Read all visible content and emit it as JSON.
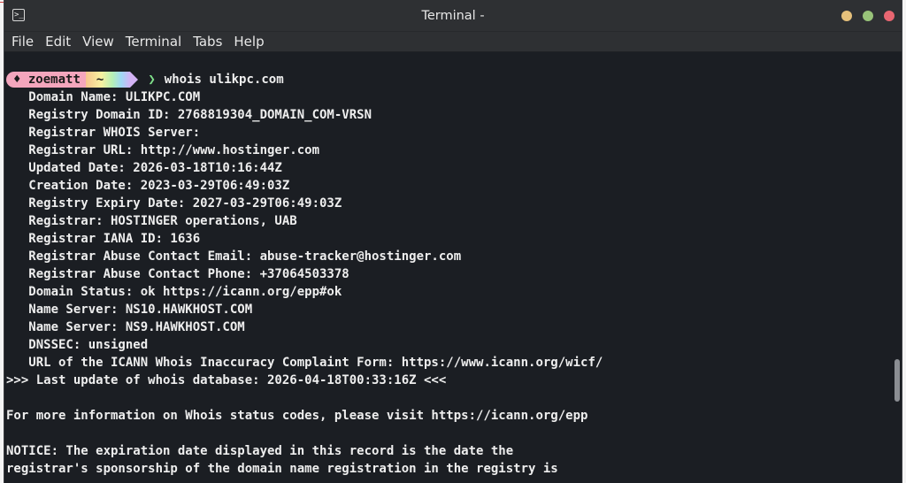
{
  "window": {
    "title": "Terminal -"
  },
  "menu": [
    "File",
    "Edit",
    "View",
    "Terminal",
    "Tabs",
    "Help"
  ],
  "prompt": {
    "user": "zoematt",
    "dir": "~",
    "user_glyph": "♦",
    "chevron": "❯",
    "command": "whois ulikpc.com"
  },
  "output": [
    "   Domain Name: ULIKPC.COM",
    "   Registry Domain ID: 2768819304_DOMAIN_COM-VRSN",
    "   Registrar WHOIS Server:",
    "   Registrar URL: http://www.hostinger.com",
    "   Updated Date: 2026-03-18T10:16:44Z",
    "   Creation Date: 2023-03-29T06:49:03Z",
    "   Registry Expiry Date: 2027-03-29T06:49:03Z",
    "   Registrar: HOSTINGER operations, UAB",
    "   Registrar IANA ID: 1636",
    "   Registrar Abuse Contact Email: abuse-tracker@hostinger.com",
    "   Registrar Abuse Contact Phone: +37064503378",
    "   Domain Status: ok https://icann.org/epp#ok",
    "   Name Server: NS10.HAWKHOST.COM",
    "   Name Server: NS9.HAWKHOST.COM",
    "   DNSSEC: unsigned",
    "   URL of the ICANN Whois Inaccuracy Complaint Form: https://www.icann.org/wicf/",
    ">>> Last update of whois database: 2026-04-18T00:33:16Z <<<",
    "",
    "For more information on Whois status codes, please visit https://icann.org/epp",
    "",
    "NOTICE: The expiration date displayed in this record is the date the",
    "registrar's sponsorship of the domain name registration in the registry is"
  ],
  "colors": {
    "terminal_bg": "#1b1e23",
    "titlebar_bg": "#2e3033",
    "text": "#eeeeee",
    "prompt_user_bg": "#f4a6bd",
    "prompt_chevron": "#7fe08a",
    "btn_min": "#e5c07b",
    "btn_max": "#98c379",
    "btn_close": "#e86671"
  },
  "icons": {
    "app": "terminal-icon",
    "scroll": "scrollbar-thumb"
  }
}
